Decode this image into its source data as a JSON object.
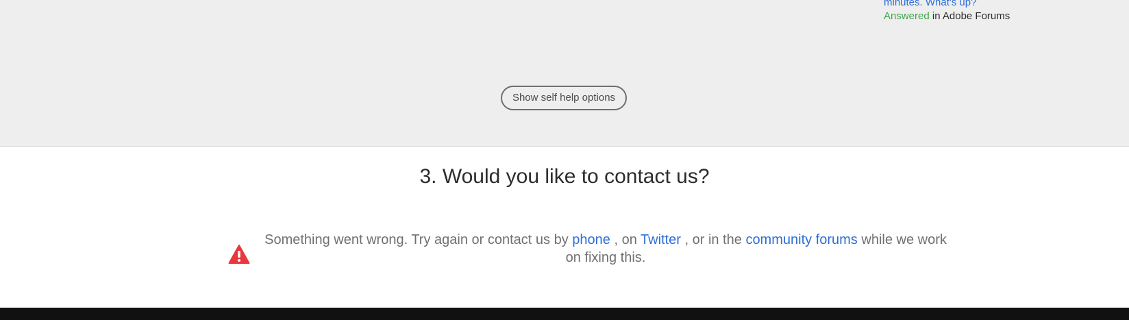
{
  "forum_snippet": {
    "title_tail": "minutes. What's up?",
    "status": "Answered",
    "location": "in Adobe Forums"
  },
  "self_help": {
    "button_label": "Show self help options"
  },
  "contact": {
    "heading": "3. Would you like to contact us?",
    "error": {
      "text_1": "Something went wrong. Try again or contact us by",
      "phone_link": "phone",
      "text_2": ", on",
      "twitter_link": "Twitter",
      "text_3": ", or in the",
      "forums_link": "community forums",
      "text_4": "while we work on fixing this."
    }
  },
  "colors": {
    "link": "#2d6ed8",
    "answered": "#3fa54a",
    "warning": "#e8383d",
    "top_background": "#eeeeee",
    "footer": "#111111"
  },
  "icons": {
    "warning": "warning-triangle-icon"
  }
}
